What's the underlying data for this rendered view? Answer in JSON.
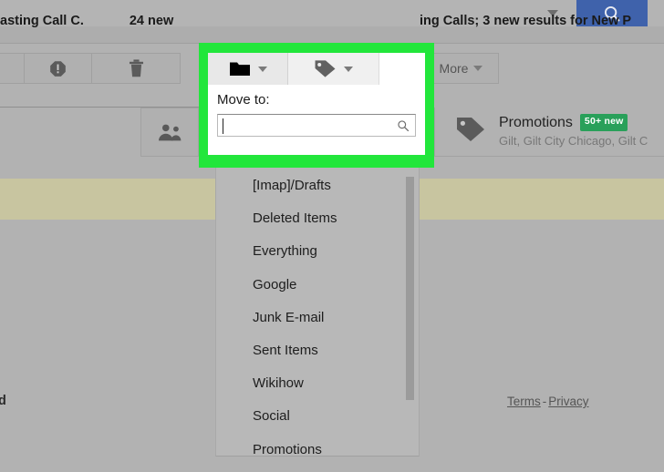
{
  "topbar": {
    "search_caret_icon": "chevron-down-icon",
    "search_button_icon": "search-icon"
  },
  "toolbar": {
    "spam_icon": "report-spam-icon",
    "trash_icon": "trash-icon",
    "more_label": "More",
    "more_caret_icon": "chevron-down-icon"
  },
  "move_popup": {
    "folder_icon": "folder-icon",
    "folder_caret_icon": "chevron-down-icon",
    "tag_icon": "label-tag-icon",
    "tag_caret_icon": "chevron-down-icon",
    "title": "Move to:",
    "search_value": "",
    "search_placeholder": "",
    "search_icon": "search-icon"
  },
  "dropdown": {
    "items": [
      {
        "label": "[Imap]/Drafts"
      },
      {
        "label": "Deleted Items"
      },
      {
        "label": "Everything"
      },
      {
        "label": "Google"
      },
      {
        "label": "Junk E-mail"
      },
      {
        "label": "Sent Items"
      },
      {
        "label": "Wikihow"
      },
      {
        "label": "Social"
      },
      {
        "label": "Promotions"
      }
    ]
  },
  "tabs": {
    "contacts_icon": "people-icon",
    "promotions": {
      "icon": "label-tag-icon",
      "title": "Promotions",
      "badge": "50+ new",
      "subtitle": "Gilt, Gilt City Chicago, Gilt C"
    }
  },
  "banner": {
    "left_text": "asting Call C.",
    "left_count": "24 new",
    "right_text": "ing Calls; 3 new results for New P"
  },
  "body": {
    "stray_char": "d"
  },
  "footer": {
    "terms_label": "Terms",
    "separator": "-",
    "privacy_label": "Privacy"
  },
  "colors": {
    "page_background": "#b2b2b2",
    "highlight_green": "#22e63b",
    "search_button_blue": "#3f62ab",
    "badge_green": "#29a05a",
    "banner_khaki": "#c8c5a0"
  }
}
